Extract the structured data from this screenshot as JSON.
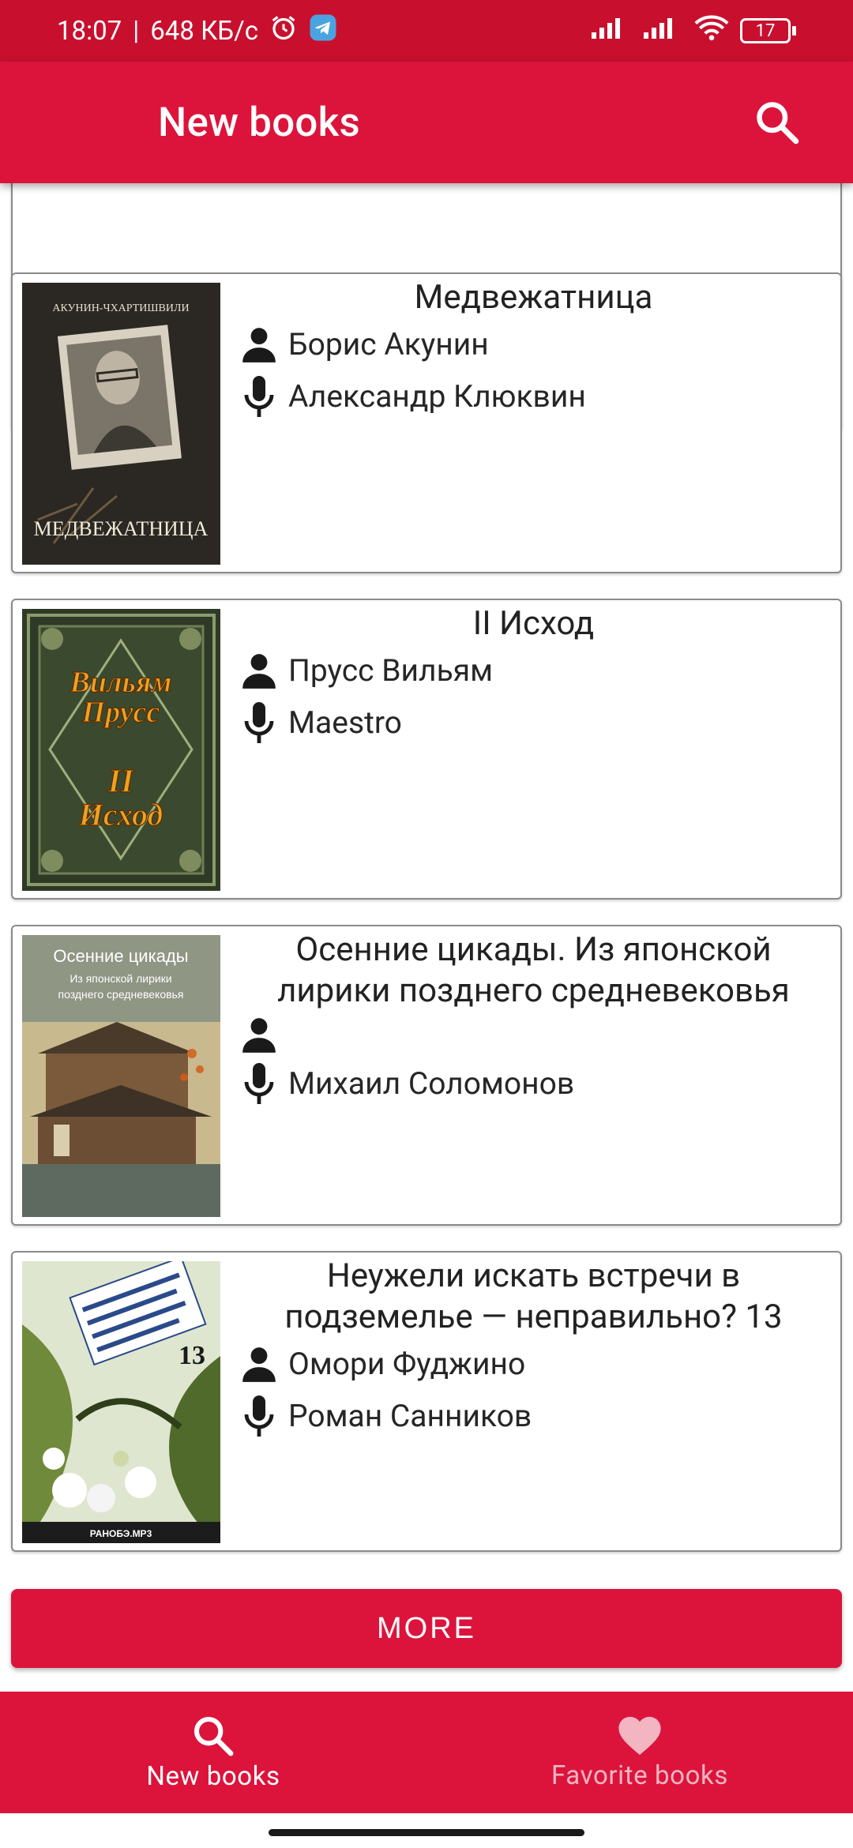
{
  "status": {
    "time": "18:07",
    "speed": "648 КБ/с",
    "battery": "17"
  },
  "app_bar": {
    "title": "New books",
    "search_icon": "search-icon"
  },
  "books": [
    {
      "title": "Медвежатница",
      "author": "Борис Акунин",
      "narrator": "Александр Клюквин",
      "cover": {
        "top_text": "АКУНИН-ЧХАРТИШВИЛИ",
        "bottom_text": "МЕДВЕЖАТНИЦА"
      }
    },
    {
      "title": "II Исход",
      "author": "Прусс Вильям",
      "narrator": "Maestro",
      "cover": {
        "line1": "Вильям",
        "line2": "Прусс",
        "line3": "II",
        "line4": "Исход"
      }
    },
    {
      "title": "Осенние цикады. Из японской лирики позднего средневековья",
      "author": "",
      "narrator": "Михаил Соломонов",
      "cover": {
        "title": "Осенние цикады",
        "sub1": "Из японской лирики",
        "sub2": "позднего средневековья"
      }
    },
    {
      "title": "Неужели искать встречи в подземелье — неправильно? 13",
      "author": "Омори Фуджино",
      "narrator": "Роман Санников",
      "cover": {
        "number": "13",
        "brand": "РАНОБЭ.MP3"
      }
    }
  ],
  "actions": {
    "more_label": "MORE"
  },
  "bottom_nav": [
    {
      "label": "New books",
      "icon": "search-icon",
      "active": true
    },
    {
      "label": "Favorite books",
      "icon": "heart-icon",
      "active": false
    }
  ],
  "colors": {
    "primary": "#dc143c",
    "status_bar": "#c8102e"
  }
}
